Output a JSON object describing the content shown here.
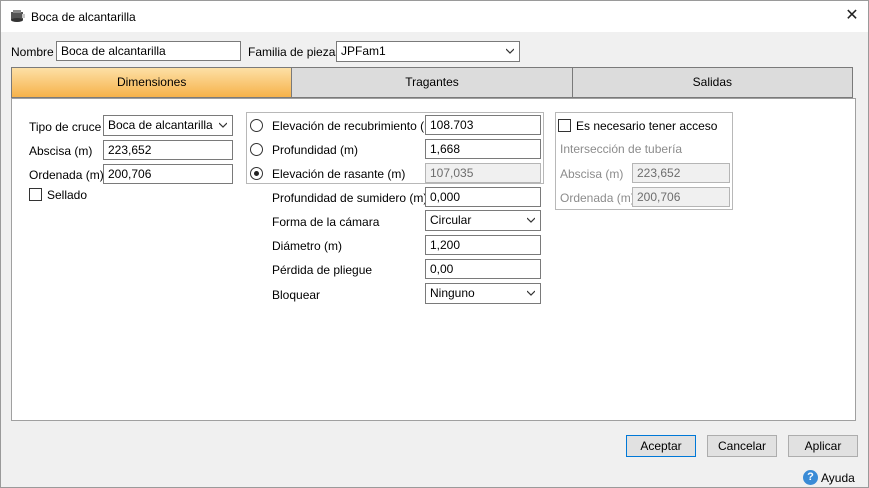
{
  "window": {
    "title": "Boca de alcantarilla",
    "close_glyph": "✕"
  },
  "header": {
    "name_label": "Nombre",
    "name_value": "Boca de alcantarilla",
    "family_label": "Familia de piezas",
    "family_value": "JPFam1"
  },
  "tabs": [
    {
      "label": "Dimensiones",
      "active": true
    },
    {
      "label": "Tragantes",
      "active": false
    },
    {
      "label": "Salidas",
      "active": false
    }
  ],
  "left": {
    "cross_type_label": "Tipo de cruce",
    "cross_type_value": "Boca de alcantarilla",
    "x_label": "Abscisa (m)",
    "x_value": "223,652",
    "y_label": "Ordenada (m)",
    "y_value": "200,706",
    "sealed_label": "Sellado",
    "sealed_checked": false
  },
  "middle": {
    "cover_elev_label": "Elevación de recubrimiento (m)",
    "cover_elev_value": "108.703",
    "depth_label": "Profundidad (m)",
    "depth_value": "1,668",
    "rim_elev_label": "Elevación de rasante (m)",
    "rim_elev_value": "107,035",
    "selected_radio": "rim_elev",
    "sump_label": "Profundidad de sumidero (m)",
    "sump_value": "0,000",
    "shape_label": "Forma de la cámara",
    "shape_value": "Circular",
    "diameter_label": "Diámetro (m)",
    "diameter_value": "1,200",
    "bend_loss_label": "Pérdida de pliegue",
    "bend_loss_value": "0,00",
    "block_label": "Bloquear",
    "block_value": "Ninguno"
  },
  "right": {
    "access_label": "Es necesario tener acceso",
    "access_checked": false,
    "intersection_label": "Intersección de tubería",
    "x_label": "Abscisa (m)",
    "x_value": "223,652",
    "y_label": "Ordenada (m)",
    "y_value": "200,706"
  },
  "footer": {
    "accept_label": "Aceptar",
    "cancel_label": "Cancelar",
    "apply_label": "Aplicar",
    "help_label": "Ayuda",
    "help_glyph": "?"
  },
  "icons": {
    "app": "manhole-app-icon",
    "chevron": "chevron-down-icon",
    "help": "help-icon",
    "close": "close-icon"
  },
  "colors": {
    "active_tab_top": "#fde0a6",
    "active_tab_bottom": "#f6b24a",
    "default_button_border": "#0078d7",
    "help_icon": "#3a8bd6"
  }
}
